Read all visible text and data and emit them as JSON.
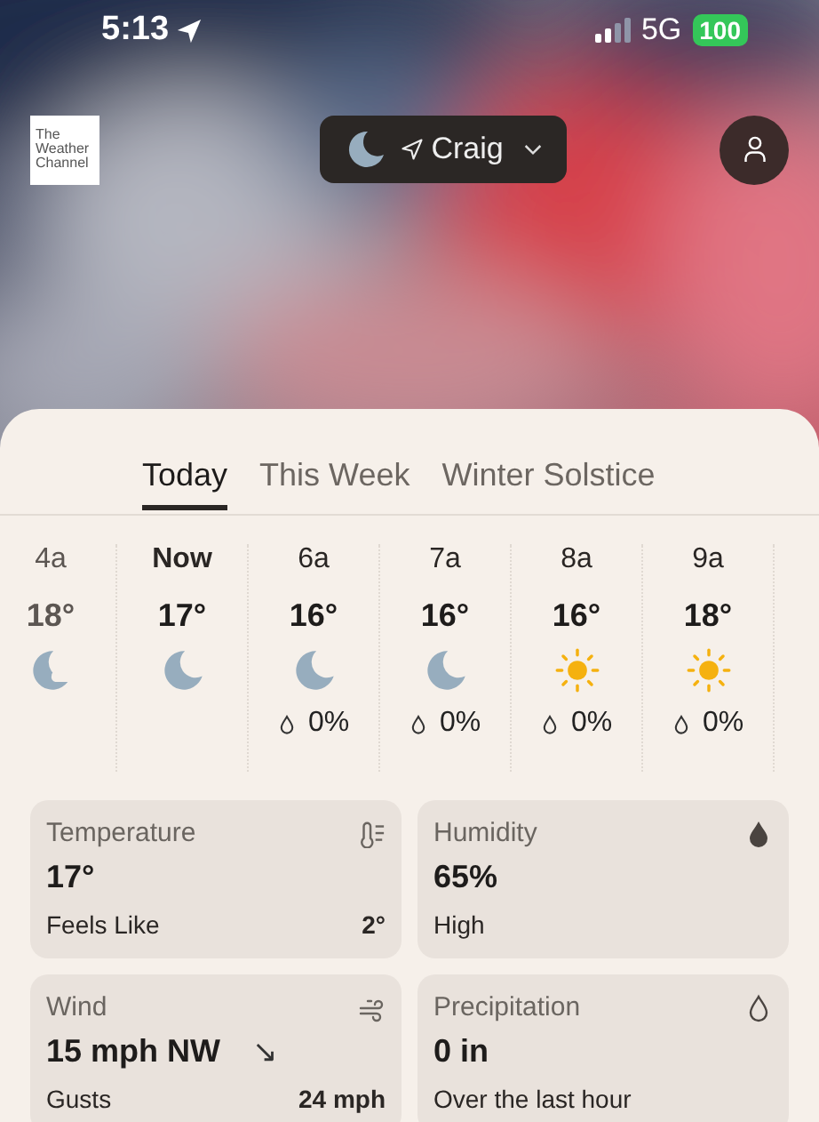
{
  "status_bar": {
    "time": "5:13",
    "network": "5G",
    "battery": "100"
  },
  "header": {
    "logo_text": "The Weather Channel",
    "location": "Craig"
  },
  "tabs": [
    {
      "label": "Today",
      "selected": true
    },
    {
      "label": "This Week",
      "selected": false
    },
    {
      "label": "Winter Solstice",
      "selected": false
    }
  ],
  "hours": [
    {
      "time": "4a",
      "temp": "18°",
      "kind": "moon-cloud",
      "past": true,
      "selected": false
    },
    {
      "time": "Now",
      "temp": "17°",
      "kind": "moon",
      "past": false,
      "selected": true
    },
    {
      "time": "6a",
      "temp": "16°",
      "kind": "moon",
      "precip": "0%",
      "past": false,
      "selected": false
    },
    {
      "time": "7a",
      "temp": "16°",
      "kind": "moon",
      "precip": "0%",
      "past": false,
      "selected": false
    },
    {
      "time": "8a",
      "temp": "16°",
      "kind": "sun",
      "precip": "0%",
      "past": false,
      "selected": false
    },
    {
      "time": "9a",
      "temp": "18°",
      "kind": "sun",
      "precip": "0%",
      "past": false,
      "selected": false
    }
  ],
  "cards": [
    {
      "title": "Temperature",
      "kind": "temperature",
      "value": "17°",
      "sub_label": "Feels Like",
      "sub_value": "2°"
    },
    {
      "title": "Humidity",
      "kind": "humidity",
      "value": "65%",
      "sub_label": "High"
    },
    {
      "title": "Wind",
      "kind": "wind",
      "value": "15 mph NW",
      "value_arrow": "↘",
      "sub_label": "Gusts",
      "sub_value": "24 mph"
    },
    {
      "title": "Precipitation",
      "kind": "precipitation",
      "value": "0 in",
      "sub_label": "Over the last hour"
    }
  ]
}
